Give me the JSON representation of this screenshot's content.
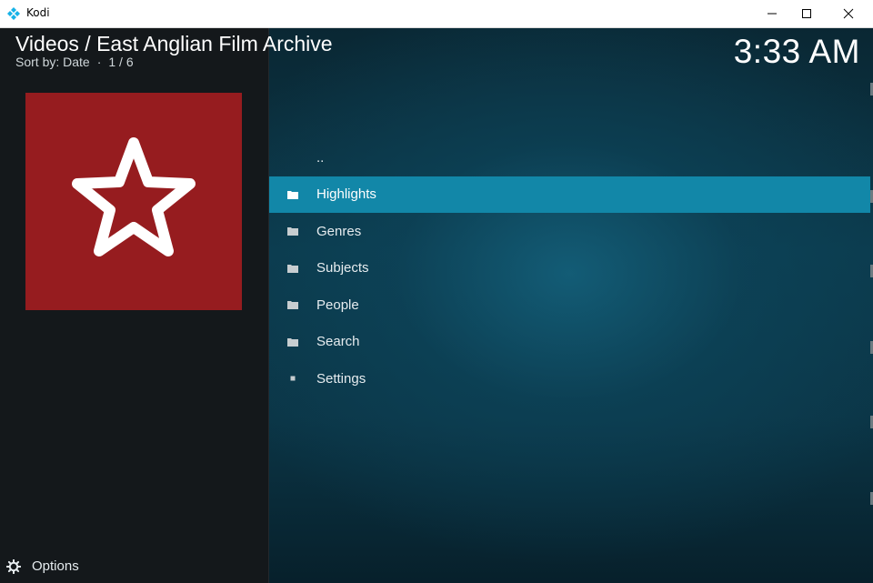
{
  "window": {
    "title": "Kodi"
  },
  "header": {
    "path": "Videos / East Anglian Film Archive",
    "sort_label": "Sort by: Date",
    "separator": "·",
    "page_info": "1 / 6",
    "clock": "3:33 AM"
  },
  "thumbnail": {
    "icon": "star-outline-icon",
    "background_color": "#961c1f"
  },
  "list": {
    "items": [
      {
        "label": "..",
        "icon": "none",
        "selected": false
      },
      {
        "label": "Highlights",
        "icon": "folder-icon",
        "selected": true
      },
      {
        "label": "Genres",
        "icon": "folder-icon",
        "selected": false
      },
      {
        "label": "Subjects",
        "icon": "folder-icon",
        "selected": false
      },
      {
        "label": "People",
        "icon": "folder-icon",
        "selected": false
      },
      {
        "label": "Search",
        "icon": "folder-icon",
        "selected": false
      },
      {
        "label": "Settings",
        "icon": "square-icon",
        "selected": false
      }
    ]
  },
  "footer": {
    "options_label": "Options",
    "options_icon": "gear-icon"
  },
  "colors": {
    "accent": "#1287a8",
    "left_pane": "#14181b",
    "text": "#e6ecef"
  }
}
